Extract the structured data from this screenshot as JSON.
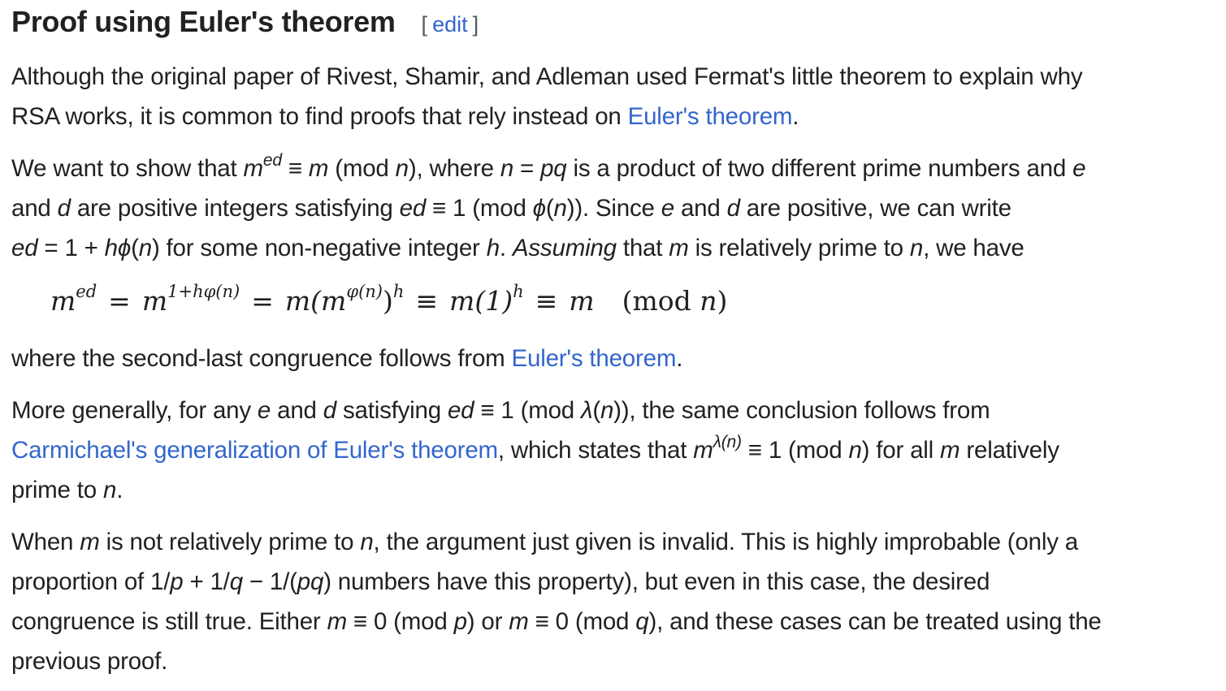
{
  "heading": {
    "title": "Proof using Euler's theorem",
    "edit_open": "[",
    "edit_label": "edit",
    "edit_close": "]"
  },
  "p1": {
    "l1": "Although the original paper of Rivest, Shamir, and Adleman used Fermat's little theorem to explain why",
    "l2_a": "RSA works, it is common to find proofs that rely instead on ",
    "l2_link": "Euler's theorem",
    "l2_b": "."
  },
  "p2": {
    "l1_a": "We want to show that ",
    "l1_m": "m",
    "l1_sup": "ed",
    "l1_b": " ≡ ",
    "l1_m2": "m",
    "l1_c": " (mod ",
    "l1_n": "n",
    "l1_d": "), where ",
    "l1_n2": "n",
    "l1_e": " = ",
    "l1_pq": "pq",
    "l1_f": " is a product of two different prime numbers and ",
    "l1_e2": "e",
    "l2_a": "and ",
    "l2_d": "d",
    "l2_b": " are positive integers satisfying ",
    "l2_ed": "ed",
    "l2_c": " ≡ 1 (mod ",
    "l2_phi": "ϕ",
    "l2_d2": "(",
    "l2_n": "n",
    "l2_e": ")). Since ",
    "l2_e2": "e",
    "l2_f": " and ",
    "l2_dd": "d",
    "l2_g": " are positive, we can write",
    "l3_ed": "ed",
    "l3_a": " = 1 + ",
    "l3_hphi": "hϕ",
    "l3_b": "(",
    "l3_n": "n",
    "l3_c": ") for some non-negative integer ",
    "l3_h": "h",
    "l3_d": ". ",
    "l3_assuming": "Assuming",
    "l3_e": " that ",
    "l3_m": "m",
    "l3_f": " is relatively prime to ",
    "l3_n2": "n",
    "l3_g": ", we have"
  },
  "equation": {
    "t1": "m",
    "t1_sup": "ed",
    "eq1": "=",
    "t2": "m",
    "t2_sup": "1+hφ(n)",
    "eq2": "=",
    "t3": "m(m",
    "t3_sup": "φ(n)",
    "t3_close": ")",
    "t3_sup2": "h",
    "eq3": "≡",
    "t4": "m(1)",
    "t4_sup": "h",
    "eq4": "≡",
    "t5": "m",
    "mod_open": "(mod ",
    "mod_n": "n",
    "mod_close": ")"
  },
  "p3": {
    "a": "where the second-last congruence follows from ",
    "link": "Euler's theorem",
    "b": "."
  },
  "p4": {
    "l1_a": "More generally, for any ",
    "l1_e": "e",
    "l1_b": " and ",
    "l1_d": "d",
    "l1_c": " satisfying ",
    "l1_ed": "ed",
    "l1_d2": " ≡ 1 (mod ",
    "l1_lambda": "λ",
    "l1_e2": "(",
    "l1_n": "n",
    "l1_f": ")), the same conclusion follows from",
    "l2_link": "Carmichael's generalization of Euler's theorem",
    "l2_a": ", which states that ",
    "l2_m": "m",
    "l2_sup": "λ(n)",
    "l2_b": " ≡ 1 (mod ",
    "l2_n": "n",
    "l2_c": ") for all ",
    "l2_m2": "m",
    "l2_d": " relatively",
    "l3_a": "prime to ",
    "l3_n": "n",
    "l3_b": "."
  },
  "p5": {
    "l1_a": "When ",
    "l1_m": "m",
    "l1_b": " is not relatively prime to ",
    "l1_n": "n",
    "l1_c": ", the argument just given is invalid. This is highly improbable (only a",
    "l2_a": "proportion of 1/",
    "l2_p": "p",
    "l2_b": " + 1/",
    "l2_q": "q",
    "l2_c": " − 1/(",
    "l2_pq": "pq",
    "l2_d": ") numbers have this property), but even in this case, the desired",
    "l3_a": "congruence is still true. Either ",
    "l3_m": "m",
    "l3_b": " ≡ 0 (mod ",
    "l3_p": "p",
    "l3_c": ") or ",
    "l3_m2": "m",
    "l3_d": " ≡ 0 (mod ",
    "l3_q": "q",
    "l3_e": "), and these cases can be treated using the",
    "l4": "previous proof."
  }
}
